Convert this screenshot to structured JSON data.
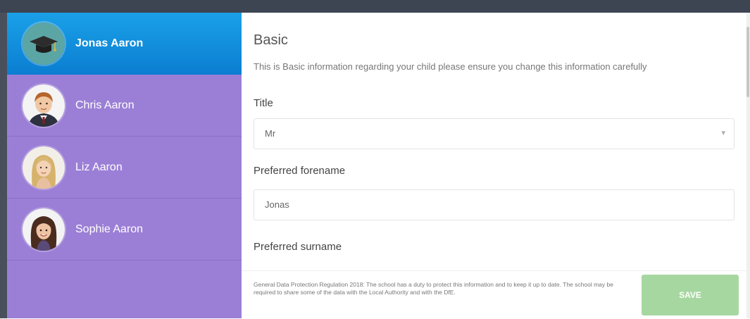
{
  "sidebar": {
    "children": [
      {
        "name": "Jonas Aaron",
        "active": true
      },
      {
        "name": "Chris Aaron",
        "active": false
      },
      {
        "name": "Liz Aaron",
        "active": false
      },
      {
        "name": "Sophie Aaron",
        "active": false
      }
    ]
  },
  "form": {
    "section_title": "Basic",
    "section_description": "This is Basic information regarding your child please ensure you change this information carefully",
    "title_label": "Title",
    "title_value": "Mr",
    "forename_label": "Preferred forename",
    "forename_value": "Jonas",
    "surname_label": "Preferred surname"
  },
  "footer": {
    "gdpr_text": "General Data Protection Regulation 2018: The school has a duty to protect this information and to keep it up to date. The school may be required to share some of the data with the Local Authority and with the DfE.",
    "save_label": "SAVE"
  },
  "colors": {
    "sidebar_bg": "#9b7fd6",
    "active_item": "#1aa0e8",
    "save_button": "#a7d7a1"
  },
  "icons": {
    "avatar_jonas": "graduation-cap-avatar-icon",
    "title_dropdown": "chevron-down-icon"
  }
}
